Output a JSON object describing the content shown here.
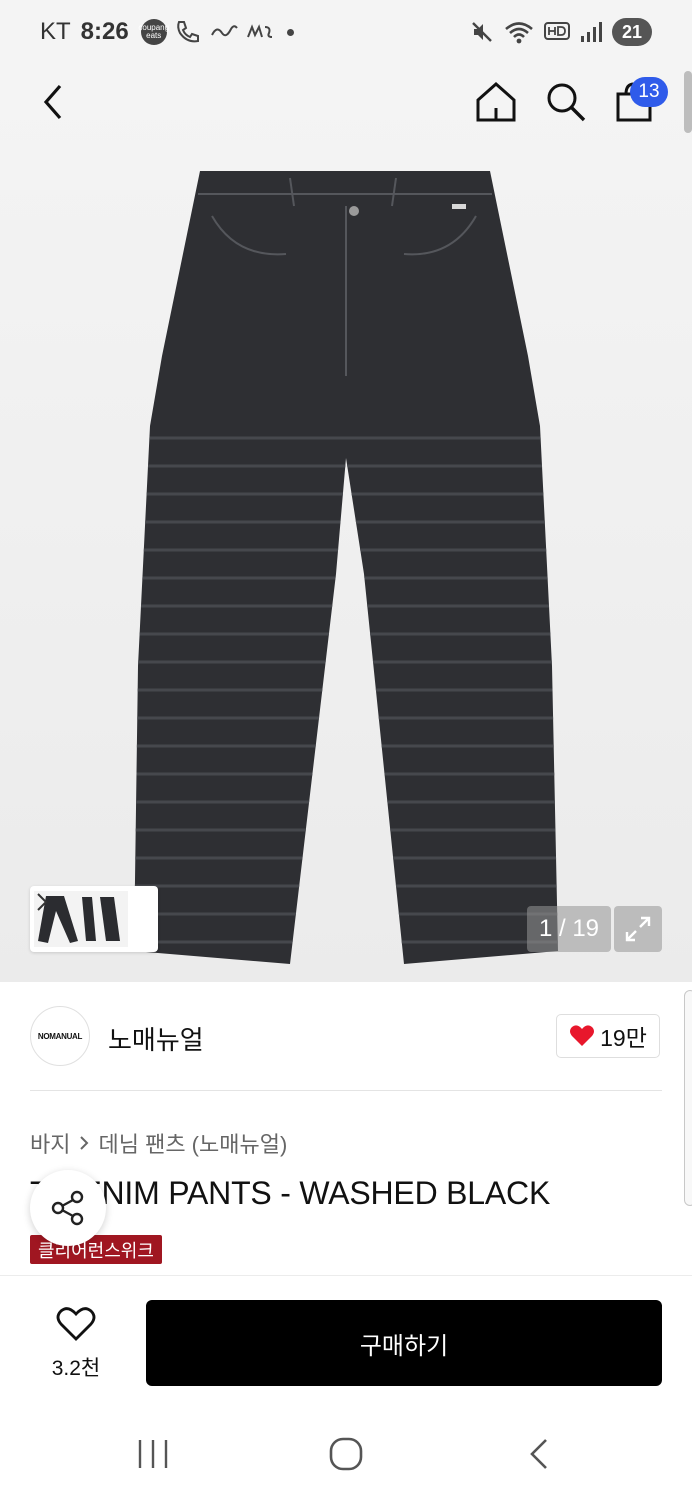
{
  "status_bar": {
    "carrier": "KT",
    "time": "8:26",
    "notif_app_1": "coupang eats",
    "battery_level": "21"
  },
  "header": {
    "back_icon": "chevron-left-icon",
    "home_icon": "home-icon",
    "search_icon": "search-icon",
    "cart_icon": "shopping-bag-icon",
    "cart_count": "13"
  },
  "gallery": {
    "current": "1",
    "separator": " / ",
    "total": "19",
    "thumbnail_icon": "chevron-right-icon",
    "expand_icon": "expand-icon"
  },
  "brand": {
    "logo_text": "NOMANUAL",
    "name": "노매뉴얼",
    "like_icon": "heart-icon",
    "like_color": "#e8172c",
    "like_count": "19만"
  },
  "breadcrumb": {
    "category": "바지",
    "subcategory": "데님 팬츠 (노매뉴얼)"
  },
  "product": {
    "title": "T  DENIM PANTS - WASHED BLACK",
    "promo_tag": "클리어런스위크",
    "promo_color": "#a01621",
    "share_icon": "share-icon"
  },
  "buy_bar": {
    "wish_count": "3.2천",
    "buy_label": "구매하기"
  },
  "system_nav": {
    "recents_icon": "recents-icon",
    "home_icon": "home-circle-icon",
    "back_icon": "back-icon"
  }
}
